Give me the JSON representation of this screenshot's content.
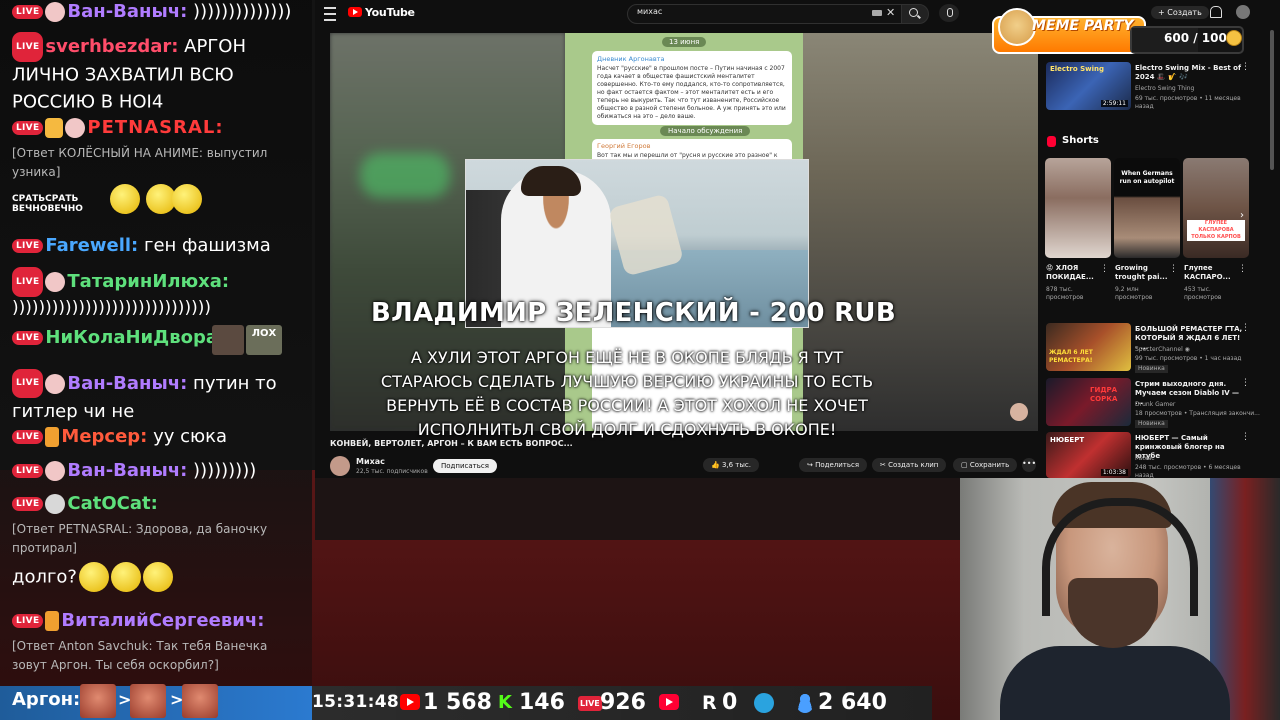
{
  "chat": {
    "messages": [
      {
        "nick": "Ван-Ваныч:",
        "nick_color": "#b07cff",
        "text": " ))))))))))))))"
      },
      {
        "nick": "sverhbezdar:",
        "nick_color": "#ff4d6a",
        "text": " АРГОН ЛИЧНО ЗАХВАТИЛ ВСЮ РОССИЮ В HOI4"
      },
      {
        "nick": "PETNASRAL:",
        "nick_color": "#ff3b3b",
        "reply": "[Ответ КОЛЁСНЫЙ НА АНИМЕ: выпустил узника]",
        "sticker": "СРАТЬСРАТЬ ВЕЧНОВЕЧНО"
      },
      {
        "nick": "Farewell:",
        "nick_color": "#4aa8ff",
        "text": " ген фашизма"
      },
      {
        "nick": "ТатаринИлюха:",
        "nick_color": "#5ee07c",
        "text": "))))))))))))))))))))))))))))))"
      },
      {
        "nick": "НиКолаНиДвора:",
        "nick_color": "#5ee07c",
        "badge": "ЛОХ"
      },
      {
        "nick": "Ван-Ваныч:",
        "nick_color": "#b07cff",
        "text": " путин то гитлер чи не"
      },
      {
        "nick": "Мерсер:",
        "nick_color": "#ff5a3c",
        "text": " уу сюка"
      },
      {
        "nick": "Ван-Ваныч:",
        "nick_color": "#b07cff",
        "text": " )))))))))"
      },
      {
        "nick": "CatOCat:",
        "nick_color": "#5ee07c",
        "reply": "[Ответ PETNASRAL: Здорова, да баночку протирал]",
        "text": "долго?"
      },
      {
        "nick": "ВиталийСергеевич:",
        "nick_color": "#b07cff",
        "reply": "[Ответ Anton Savchuk: Так тебя Ванечка зовут Аргон. Ты себя оскорбил?]"
      }
    ],
    "live_badge": "LIVE",
    "argon_label": "Аргон:",
    "argon_separator": ">"
  },
  "youtube": {
    "logo_text": "YouTube",
    "search_value": "михас",
    "create_label": "+ Создать",
    "telegram": {
      "date": "13 июня",
      "author": "Дневник Аргонавта",
      "body": "Насчет \"русские\" в прошлом посте – Путин начиная с 2007 года качает в обществе фашистский менталитет совершенно. Кто-то ему поддался, кто-то сопротивляется, но факт остается фактом – этот менталитет есть и его теперь не выкурить. Так что тут изванените, Российское общество в разной степени больное. А уж принять это или обижаться на это – дело ваше.",
      "discussion": "Начало обсуждения",
      "reply_author": "Георгий Егоров",
      "reply_body": "Вот так мы и перешли от \"русня и русские это разное\" к"
    },
    "video_overlay": {
      "title": "ВЛАДИМИР ЗЕЛЕНСКИЙ - 200 RUB",
      "message": "А ХУЛИ ЭТОТ АРГОН ЕЩЁ НЕ В ОКОПЕ БЛЯДЬ Я ТУТ СТАРАЮСЬ СДЕЛАТЬ ЛУЧШУЮ ВЕРСИЮ УКРАИНЫ ТО ЕСТЬ ВЕРНУТЬ ЕЁ В СОСТАВ РОССИИ! А ЭТОТ ХОХОЛ НЕ ХОЧЕТ ИСПОЛНИТЬЛ СВОЙ ДОЛГ И СДОХНУТЬ В ОКОПЕ!"
    },
    "video_info": {
      "title": "КОНВЕЙ, ВЕРТОЛЕТ, АРГОН – К ВАМ ЕСТЬ ВОПРОС...",
      "channel": "Михас",
      "subscribers": "22,5 тыс. подписчиков",
      "subscribe_label": "Подписаться",
      "likes": "3,6 тыс.",
      "share_label": "Поделиться",
      "clip_label": "Создать клип",
      "save_label": "Сохранить",
      "more_label": "•••"
    },
    "sidebar": {
      "top_video": {
        "title": "Electro Swing Mix - Best of 2024 🎩 🎷 🎶",
        "channel": "Electro Swing Thing",
        "meta": "69 тыс. просмотров • 11 месяцев назад",
        "duration": "2:59:11",
        "thumb_text": "Electro Swing"
      },
      "shorts_label": "Shorts",
      "shorts": [
        {
          "title": "😡 ХЛОЯ ПОКИДАЕ...",
          "views": "878 тыс. просмотров"
        },
        {
          "title": "Growing trought pai...",
          "views": "9,2 млн просмотров",
          "thumb_text": "When Germans run on autopilot"
        },
        {
          "title": "Глупее КАСПАРО...",
          "views": "453 тыс. просмотров",
          "thumb_text": "ГЛУПЕЕ КАСПАРОВА ТОЛЬКО КАРПОВ"
        }
      ],
      "videos": [
        {
          "title": "БОЛЬШОЙ РЕМАСТЕР ГТА, КОТОРЫЙ Я ЖДАЛ 6 ЛЕТ! - ...",
          "channel": "SpecterChannel ◉",
          "meta": "99 тыс. просмотров • 1 час назад",
          "badge": "Новинка",
          "thumb_text": "ЖДАЛ 6 ЛЕТ РЕМАСТЕРА!"
        },
        {
          "title": "Стрим выходного дня. Мучаем сезон Diablo IV — ...",
          "channel": "Drunk Gamer",
          "meta": "18 просмотров • Трансляция закончи...",
          "badge": "Новинка",
          "thumb_text": "ГИДРА СОРКА"
        },
        {
          "title": "НЮБЕРТ — Самый кринжовый блогер на ютубе",
          "channel": "Михас",
          "meta": "248 тыс. просмотров • 6 месяцев назад",
          "duration": "1:03:38",
          "thumb_text": "НЮБЕРТ"
        }
      ]
    }
  },
  "meme_party": {
    "title": "MEME PARTY",
    "score": "600 / 1000",
    "progress": 0.6
  },
  "stats_bar": {
    "time": "15:31:48",
    "youtube_count": "1 568",
    "kick_icon": "K",
    "kick_count": "146",
    "live_badge": "LIVE",
    "live_count": "926",
    "play_count": "",
    "r_icon": "R",
    "r_count": "0",
    "telegram_count": "",
    "users_count": "2 640"
  },
  "colors": {
    "youtube_red": "#ff0000",
    "kick_green": "#53fc18",
    "live_red": "#e0243a",
    "telegram_blue": "#2aa3df",
    "users_blue": "#4a9fff"
  }
}
